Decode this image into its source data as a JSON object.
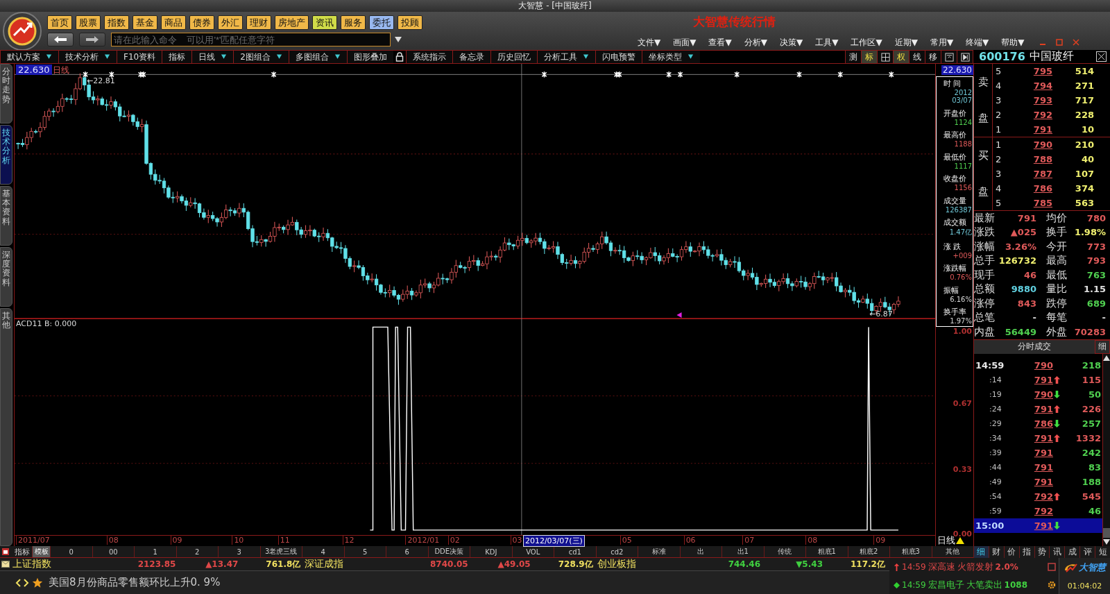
{
  "window": {
    "title": "大智慧 - [中国玻纤]"
  },
  "app_title": "大智慧传统行情",
  "nav_buttons": [
    {
      "label": "首页",
      "color": "#f0b848"
    },
    {
      "label": "股票",
      "color": "#f0b848"
    },
    {
      "label": "指数",
      "color": "#f0b848"
    },
    {
      "label": "基金",
      "color": "#f0b848"
    },
    {
      "label": "商品",
      "color": "#f0b848"
    },
    {
      "label": "债券",
      "color": "#f0b848"
    },
    {
      "label": "外汇",
      "color": "#f0b848"
    },
    {
      "label": "理财",
      "color": "#f0b848"
    },
    {
      "label": "房地产",
      "color": "#f0b848"
    },
    {
      "label": "资讯",
      "color": "#d0dc48"
    },
    {
      "label": "服务",
      "color": "#f0b848"
    },
    {
      "label": "委托",
      "color": "#98b8f0"
    },
    {
      "label": "投顾",
      "color": "#f0b848"
    }
  ],
  "command": {
    "placeholder": "请在此输入命令    可以用'*'匹配任意字符"
  },
  "menus": [
    "文件▼",
    "画面▼",
    "查看▼",
    "分析▼",
    "决策▼",
    "工具▼",
    "工作区▼",
    "近期▼",
    "常用▼",
    "终端▼",
    "帮助▼"
  ],
  "toolbar": [
    {
      "kind": "button",
      "label": "默认方案",
      "dropdown": true
    },
    {
      "kind": "button",
      "label": "技术分析",
      "dropdown": true
    },
    {
      "kind": "button",
      "label": "F10资料",
      "dropdown": false
    },
    {
      "kind": "button",
      "label": "指标",
      "dropdown": false
    },
    {
      "kind": "button",
      "label": "日线",
      "dropdown": true
    },
    {
      "kind": "button",
      "label": "2图组合",
      "dropdown": true
    },
    {
      "kind": "button",
      "label": "多图组合",
      "dropdown": true
    },
    {
      "kind": "button",
      "label": "图形叠加",
      "dropdown": false
    },
    {
      "kind": "lock"
    },
    {
      "kind": "button",
      "label": "系统指示",
      "dropdown": false
    },
    {
      "kind": "button",
      "label": "备忘录",
      "dropdown": false
    },
    {
      "kind": "button",
      "label": "历史回忆",
      "dropdown": false
    },
    {
      "kind": "button",
      "label": "分析工具",
      "dropdown": true
    },
    {
      "kind": "button",
      "label": "闪电预警",
      "dropdown": false
    },
    {
      "kind": "button",
      "label": "坐标类型",
      "dropdown": true
    }
  ],
  "view_buttons": [
    {
      "kind": "text",
      "label": "测",
      "selected": false
    },
    {
      "kind": "text",
      "label": "标",
      "selected": true
    },
    {
      "kind": "grid",
      "selected": false
    },
    {
      "kind": "text",
      "label": "权",
      "selected": true
    },
    {
      "kind": "text",
      "label": "线",
      "selected": false
    },
    {
      "kind": "text",
      "label": "移",
      "selected": false
    },
    {
      "kind": "panel",
      "selected": false
    },
    {
      "kind": "play",
      "selected": false
    }
  ],
  "stock": {
    "code": "600176",
    "name": "中国玻纤"
  },
  "side_tabs": [
    {
      "label": "分时走势",
      "selected": false
    },
    {
      "label": "技术分析",
      "selected": true
    },
    {
      "label": "基本资料",
      "selected": false
    },
    {
      "label": "深度资料",
      "selected": false
    },
    {
      "label": "其他",
      "selected": false
    }
  ],
  "price_chart": {
    "top_price": "22.630",
    "period": "日线",
    "high_label": "←22.81",
    "low_label": "←6.87"
  },
  "indicator": {
    "label": "ACD11  B: 0.000",
    "y_labels": [
      "1.00",
      "0.67",
      "0.33",
      "0.00"
    ]
  },
  "axis": {
    "top_price": "22.630",
    "period": "日线"
  },
  "dates": [
    {
      "label": "2011/07",
      "selected": false
    },
    {
      "label": "08",
      "selected": false
    },
    {
      "label": "09",
      "selected": false
    },
    {
      "label": "10",
      "selected": false
    },
    {
      "label": "11",
      "selected": false
    },
    {
      "label": "12",
      "selected": false
    },
    {
      "label": "2012/01",
      "selected": false
    },
    {
      "label": "02",
      "selected": false
    },
    {
      "label": "03",
      "selected": false
    },
    {
      "label": "2012/03/07(三)",
      "selected": true
    },
    {
      "label": "05",
      "selected": false
    },
    {
      "label": "06",
      "selected": false
    },
    {
      "label": "07",
      "selected": false
    },
    {
      "label": "08",
      "selected": false
    },
    {
      "label": "09",
      "selected": false
    }
  ],
  "info_box": [
    {
      "label": "时 间",
      "values": [
        "2012",
        "03/07"
      ],
      "color": "#70c8d8"
    },
    {
      "label": "开盘价",
      "values": [
        "1124"
      ],
      "color": "#50d050"
    },
    {
      "label": "最高价",
      "values": [
        "1188"
      ],
      "color": "#e05a5a"
    },
    {
      "label": "最低价",
      "values": [
        "1117"
      ],
      "color": "#50d050"
    },
    {
      "label": "收盘价",
      "values": [
        "1156"
      ],
      "color": "#e05a5a"
    },
    {
      "label": "成交量",
      "values": [
        "126387"
      ],
      "color": "#70c8d8"
    },
    {
      "label": "成交额",
      "values": [
        "1.47亿"
      ],
      "color": "#70c8d8"
    },
    {
      "label": "涨 跌",
      "values": [
        "+009"
      ],
      "color": "#e05a5a"
    },
    {
      "label": "涨跌幅",
      "values": [
        "0.76%"
      ],
      "color": "#e05a5a"
    },
    {
      "label": "振幅",
      "values": [
        "6.16%"
      ],
      "color": "#d8d8d8"
    },
    {
      "label": "换手率",
      "values": [
        "1.97%"
      ],
      "color": "#d8d8d8"
    }
  ],
  "order_book": {
    "sell_label": [
      "卖",
      "盘"
    ],
    "buy_label": [
      "买",
      "盘"
    ],
    "sell": [
      {
        "level": "5",
        "price": "795",
        "volume": "514"
      },
      {
        "level": "4",
        "price": "794",
        "volume": "271"
      },
      {
        "level": "3",
        "price": "793",
        "volume": "717"
      },
      {
        "level": "2",
        "price": "792",
        "volume": "228"
      },
      {
        "level": "1",
        "price": "791",
        "volume": "10"
      }
    ],
    "buy": [
      {
        "level": "1",
        "price": "790",
        "volume": "210"
      },
      {
        "level": "2",
        "price": "788",
        "volume": "40"
      },
      {
        "level": "3",
        "price": "787",
        "volume": "107"
      },
      {
        "level": "4",
        "price": "786",
        "volume": "374"
      },
      {
        "level": "5",
        "price": "785",
        "volume": "563"
      }
    ]
  },
  "quote_stats": [
    {
      "label": "最新",
      "value": "791",
      "color": "#e05a5a"
    },
    {
      "label": "均价",
      "value": "780",
      "color": "#e05a5a"
    },
    {
      "label": "涨跌",
      "value": "▲025",
      "color": "#e05a5a"
    },
    {
      "label": "换手",
      "value": "1.98%",
      "color": "#f0f070"
    },
    {
      "label": "涨幅",
      "value": "3.26%",
      "color": "#e05a5a"
    },
    {
      "label": "今开",
      "value": "773",
      "color": "#e05a5a"
    },
    {
      "label": "总手",
      "value": "126732",
      "color": "#f0f070"
    },
    {
      "label": "最高",
      "value": "793",
      "color": "#e05a5a"
    },
    {
      "label": "现手",
      "value": "46",
      "color": "#e05a5a"
    },
    {
      "label": "最低",
      "value": "763",
      "color": "#50d050"
    },
    {
      "label": "总额",
      "value": "9880",
      "color": "#60d0e0"
    },
    {
      "label": "量比",
      "value": "1.15",
      "color": "#e0e0e0"
    },
    {
      "label": "涨停",
      "value": "843",
      "color": "#e05a5a"
    },
    {
      "label": "跌停",
      "value": "689",
      "color": "#50d050"
    },
    {
      "label": "总笔",
      "value": "-",
      "color": "#e0e0e0"
    },
    {
      "label": "每笔",
      "value": "-",
      "color": "#e0e0e0"
    },
    {
      "label": "内盘",
      "value": "56449",
      "color": "#50d050"
    },
    {
      "label": "外盘",
      "value": "70283",
      "color": "#e05a5a"
    }
  ],
  "trades": {
    "title": "分时成交",
    "detail_tab": "细",
    "rows": [
      {
        "kind": "minute",
        "time": "14:59",
        "price": "790",
        "uptick": false,
        "downtick": false,
        "volume": "218",
        "color": "#50d050",
        "selected": false
      },
      {
        "kind": "second",
        "time": ":14",
        "price": "791",
        "uptick": true,
        "downtick": false,
        "volume": "115",
        "color": "#e05a5a",
        "selected": false
      },
      {
        "kind": "second",
        "time": ":19",
        "price": "790",
        "uptick": false,
        "downtick": true,
        "volume": "50",
        "color": "#50d050",
        "selected": false
      },
      {
        "kind": "second",
        "time": ":24",
        "price": "791",
        "uptick": true,
        "downtick": false,
        "volume": "226",
        "color": "#e05a5a",
        "selected": false
      },
      {
        "kind": "second",
        "time": ":29",
        "price": "786",
        "uptick": false,
        "downtick": true,
        "volume": "257",
        "color": "#50d050",
        "selected": false
      },
      {
        "kind": "second",
        "time": ":34",
        "price": "791",
        "uptick": true,
        "downtick": false,
        "volume": "1332",
        "color": "#e05a5a",
        "selected": false
      },
      {
        "kind": "second",
        "time": ":39",
        "price": "791",
        "uptick": false,
        "downtick": false,
        "volume": "242",
        "color": "#50d050",
        "selected": false
      },
      {
        "kind": "second",
        "time": ":44",
        "price": "791",
        "uptick": false,
        "downtick": false,
        "volume": "83",
        "color": "#50d050",
        "selected": false
      },
      {
        "kind": "second",
        "time": ":49",
        "price": "791",
        "uptick": false,
        "downtick": false,
        "volume": "188",
        "color": "#50d050",
        "selected": false
      },
      {
        "kind": "second",
        "time": ":54",
        "price": "792",
        "uptick": true,
        "downtick": false,
        "volume": "545",
        "color": "#e05a5a",
        "selected": false
      },
      {
        "kind": "second",
        "time": ":59",
        "price": "792",
        "uptick": false,
        "downtick": false,
        "volume": "46",
        "color": "#50d050",
        "selected": false
      },
      {
        "kind": "minute",
        "time": "15:00",
        "price": "791",
        "uptick": false,
        "downtick": true,
        "selected": true
      }
    ]
  },
  "panel_tabs": [
    {
      "label": "细",
      "selected": true
    },
    {
      "label": "财",
      "selected": false
    },
    {
      "label": "价",
      "selected": false
    },
    {
      "label": "指",
      "selected": false
    },
    {
      "label": "势",
      "selected": false
    },
    {
      "label": "讯",
      "selected": false
    },
    {
      "label": "成",
      "selected": false
    },
    {
      "label": "评",
      "selected": false
    },
    {
      "label": "短",
      "selected": false
    }
  ],
  "indicator_tabs": {
    "title": "指标",
    "items": [
      {
        "label": "模板",
        "selected": true
      },
      {
        "label": "0",
        "selected": false
      },
      {
        "label": "00",
        "selected": false
      },
      {
        "label": "1",
        "selected": false
      },
      {
        "label": "2",
        "selected": false
      },
      {
        "label": "3",
        "selected": false
      },
      {
        "label": "3老虎三线",
        "selected": false
      },
      {
        "label": "4",
        "selected": false
      },
      {
        "label": "5",
        "selected": false
      },
      {
        "label": "6",
        "selected": false
      },
      {
        "label": "DDE决策",
        "selected": false
      },
      {
        "label": "KDJ",
        "selected": false
      },
      {
        "label": "VOL",
        "selected": false
      },
      {
        "label": "cd1",
        "selected": false
      },
      {
        "label": "cd2",
        "selected": false
      },
      {
        "label": "标准",
        "selected": false
      },
      {
        "label": "出",
        "selected": false
      },
      {
        "label": "出1",
        "selected": false
      },
      {
        "label": "传统",
        "selected": false
      },
      {
        "label": "粗底1",
        "selected": false
      },
      {
        "label": "粗底2",
        "selected": false
      },
      {
        "label": "粗底3",
        "selected": false
      },
      {
        "label": "其他",
        "selected": false
      }
    ]
  },
  "indices": [
    {
      "name": "上证指数",
      "value": "2123.85",
      "change": "▲13.47",
      "rising": true,
      "amount": "761.8亿"
    },
    {
      "name": "深证成指",
      "value": "8740.05",
      "change": "▲49.05",
      "rising": true,
      "amount": "728.9亿"
    },
    {
      "name": "创业板指",
      "value": "744.46",
      "change": "▼5.43",
      "rising": false,
      "amount": "117.2亿"
    }
  ],
  "news": {
    "headline": "美国8月份商品零售额环比上升0. 9%"
  },
  "alerts": [
    {
      "rising": true,
      "time": "14:59",
      "stock": "深高速",
      "event": "火箭发射",
      "value": "2.0%"
    },
    {
      "rising": false,
      "time": "14:59",
      "stock": "宏昌电子",
      "event": "大笔卖出",
      "value": "1088"
    }
  ],
  "brand": "大智慧",
  "clock": "01:04:02"
}
